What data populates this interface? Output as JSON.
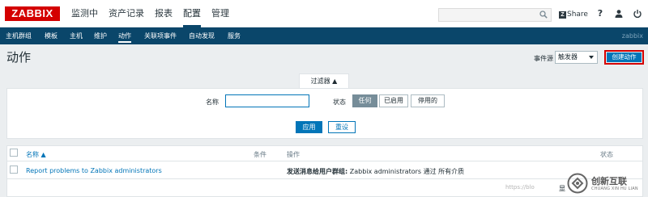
{
  "header": {
    "logo": "ZABBIX",
    "menu": [
      "监测中",
      "资产记录",
      "报表",
      "配置",
      "管理"
    ],
    "active_menu_index": 3,
    "search": {
      "value": "",
      "placeholder": ""
    },
    "share_label": "Share",
    "help_label": "?"
  },
  "subnav": {
    "items": [
      "主机群组",
      "模板",
      "主机",
      "维护",
      "动作",
      "关联项事件",
      "自动发现",
      "服务"
    ],
    "active_index": 4,
    "server_name": "zabbix"
  },
  "page": {
    "title": "动作",
    "event_source_label": "事件源",
    "event_source_value": "触发器",
    "create_button": "创建动作"
  },
  "filter": {
    "tab_label": "过滤器 ▲",
    "name_label": "名称",
    "name_value": "",
    "status_label": "状态",
    "status_options": [
      "任何",
      "已启用",
      "停用的"
    ],
    "status_selected": 0,
    "apply_label": "应用",
    "reset_label": "重设"
  },
  "table": {
    "columns": [
      "名称 ▲",
      "条件",
      "操作",
      "状态"
    ],
    "rows": [
      {
        "name": "Report problems to Zabbix administrators",
        "conditions": "",
        "operations_bold": "发送消息给用户群组:",
        "operations_rest": " Zabbix administrators 通过 所有介质",
        "status": "显"
      }
    ]
  },
  "watermark": {
    "url_text": "https://blo",
    "brand": "创新互联",
    "brand_sub": "CHUANG XIN HU LIAN"
  },
  "colors": {
    "logo_red": "#d40000",
    "nav_blue": "#0a466a",
    "button_blue": "#0275b8",
    "highlight_red": "#d40000"
  },
  "icons": [
    "search-icon",
    "user-icon",
    "power-icon",
    "checkbox-icon"
  ]
}
